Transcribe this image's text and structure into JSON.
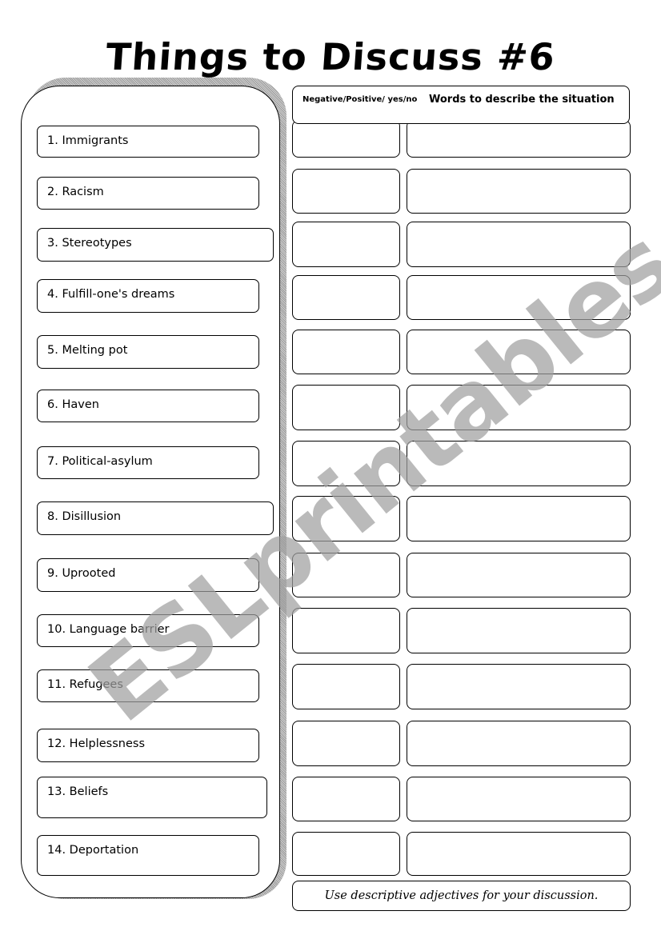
{
  "worksheet": {
    "title": "Things to Discuss #6",
    "headers": {
      "rating_column": "Negative/Positive/ yes/no",
      "description_column": "Words to describe the situation"
    },
    "items": [
      {
        "label": "1. Immigrants"
      },
      {
        "label": "2. Racism"
      },
      {
        "label": "3. Stereotypes"
      },
      {
        "label": "4. Fulfill-one's dreams"
      },
      {
        "label": "5. Melting pot"
      },
      {
        "label": "6. Haven"
      },
      {
        "label": "7. Political-asylum"
      },
      {
        "label": "8. Disillusion"
      },
      {
        "label": "9. Uprooted"
      },
      {
        "label": "10. Language barrier"
      },
      {
        "label": "11. Refugees"
      },
      {
        "label": "12.  Helplessness"
      },
      {
        "label": "13. Beliefs"
      },
      {
        "label": "14.  Deportation"
      }
    ],
    "answers": [
      {
        "rating": "",
        "description": ""
      },
      {
        "rating": "",
        "description": ""
      },
      {
        "rating": "",
        "description": ""
      },
      {
        "rating": "",
        "description": ""
      },
      {
        "rating": "",
        "description": ""
      },
      {
        "rating": "",
        "description": ""
      },
      {
        "rating": "",
        "description": ""
      },
      {
        "rating": "",
        "description": ""
      },
      {
        "rating": "",
        "description": ""
      },
      {
        "rating": "",
        "description": ""
      },
      {
        "rating": "",
        "description": ""
      },
      {
        "rating": "",
        "description": ""
      },
      {
        "rating": "",
        "description": ""
      },
      {
        "rating": "",
        "description": ""
      }
    ],
    "footer_note": "Use descriptive adjectives for your discussion.",
    "watermark": "ESLprintables.com"
  }
}
